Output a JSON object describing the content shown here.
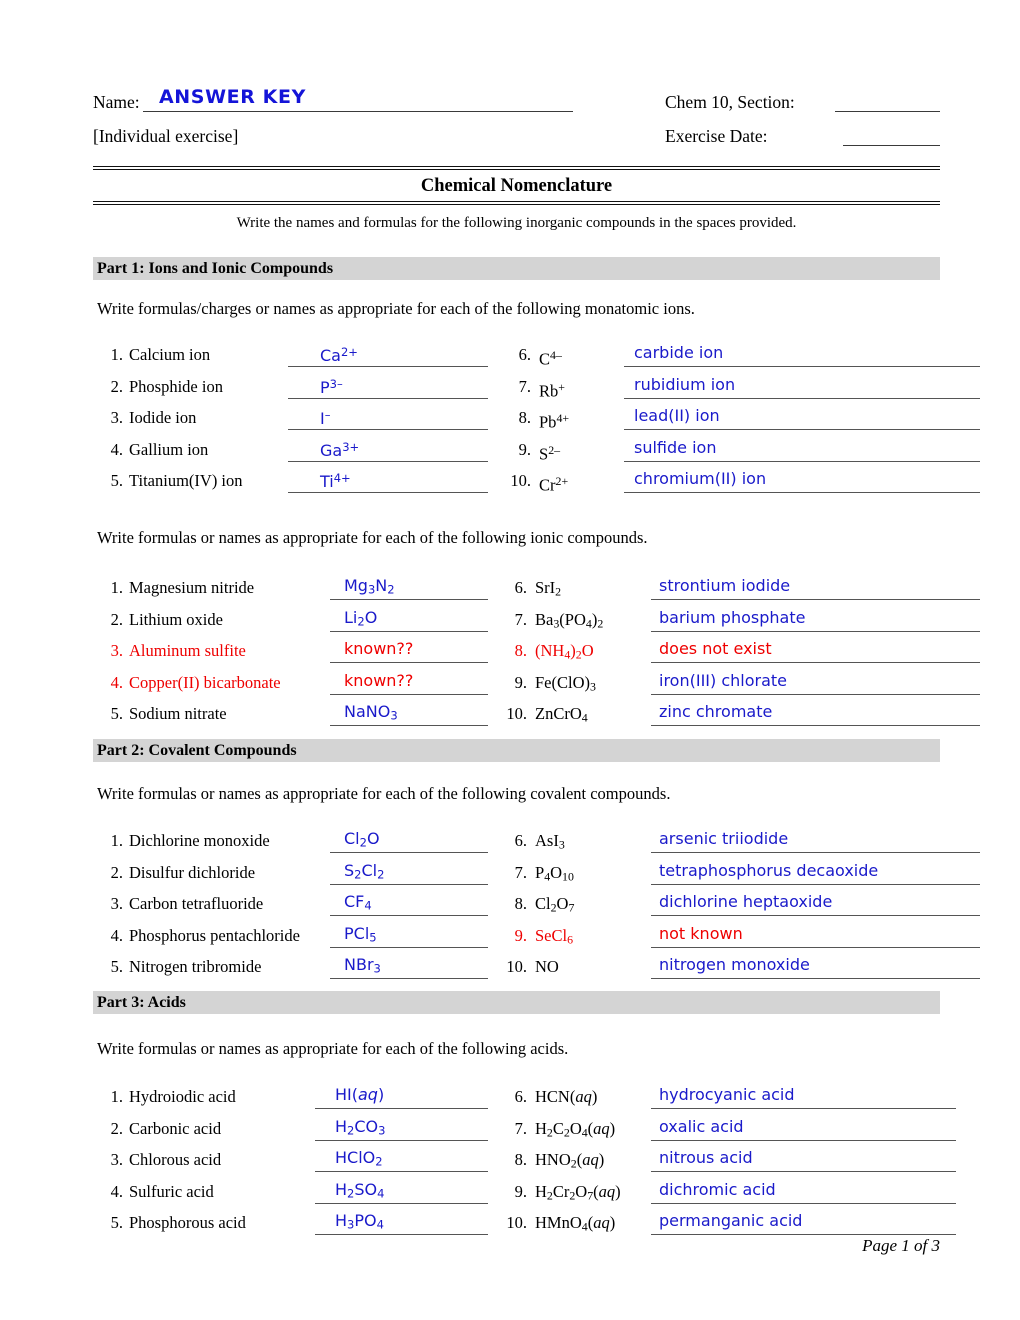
{
  "header": {
    "name_label": "Name:",
    "answer_key": "ANSWER KEY",
    "individual_exercise": "[Individual  exercise]",
    "chem_section_label": "Chem 10, Section:",
    "exercise_date_label": "Exercise Date:"
  },
  "title": "Chemical Nomenclature",
  "intro": "Write the names and formulas for the following inorganic compounds in the spaces provided.",
  "colors": {
    "answer_blue": "#1a1aca",
    "answer_red": "#ee0000",
    "section_bar": "#d4d4d4",
    "answer_key_blue": "#1414d8"
  },
  "part1": {
    "bar": "Part 1:  Ions and Ionic Compounds",
    "instruction_ions": "Write formulas/charges or names as appropriate for each of the following monatomic ions.",
    "instruction_ionic": "Write formulas or names as appropriate for each of the following ionic compounds.",
    "ions_left": [
      {
        "n": "1.",
        "prompt": "Calcium ion",
        "answer_html": "Ca<sup>2+</sup>",
        "red": false
      },
      {
        "n": "2.",
        "prompt": "Phosphide ion",
        "answer_html": "P<sup>3–</sup>",
        "red": false
      },
      {
        "n": "3.",
        "prompt": "Iodide ion",
        "answer_html": "I<sup>–</sup>",
        "red": false
      },
      {
        "n": "4.",
        "prompt": "Gallium ion",
        "answer_html": "Ga<sup>3+</sup>",
        "red": false
      },
      {
        "n": "5.",
        "prompt": "Titanium(IV) ion",
        "answer_html": "Ti<sup>4+</sup>",
        "red": false
      }
    ],
    "ions_right": [
      {
        "n": "6.",
        "prompt_html": "C<sup>4–</sup>",
        "answer_html": "carbide ion",
        "red": false
      },
      {
        "n": "7.",
        "prompt_html": "Rb<sup>+</sup>",
        "answer_html": "rubidium ion",
        "red": false
      },
      {
        "n": "8.",
        "prompt_html": "Pb<sup>4+</sup>",
        "answer_html": "lead(II) ion",
        "red": false
      },
      {
        "n": "9.",
        "prompt_html": "S<sup>2–</sup>",
        "answer_html": "sulfide ion",
        "red": false
      },
      {
        "n": "10.",
        "prompt_html": "Cr<sup>2+</sup>",
        "answer_html": "chromium(II) ion",
        "red": false
      }
    ],
    "ionic_left": [
      {
        "n": "1.",
        "prompt": "Magnesium nitride",
        "answer_html": "Mg<sub>3</sub>N<sub>2</sub>",
        "red": false
      },
      {
        "n": "2.",
        "prompt": "Lithium oxide",
        "answer_html": "Li<sub>2</sub>O",
        "red": false
      },
      {
        "n": "3.",
        "prompt": "Aluminum sulfite",
        "answer_html": "known??",
        "red": true
      },
      {
        "n": "4.",
        "prompt": "Copper(II) bicarbonate",
        "answer_html": "known??",
        "red": true
      },
      {
        "n": "5.",
        "prompt": "Sodium nitrate",
        "answer_html": "NaNO<sub>3</sub>",
        "red": false
      }
    ],
    "ionic_right": [
      {
        "n": "6.",
        "prompt_html": "SrI<sub>2</sub>",
        "answer_html": "strontium iodide",
        "red": false
      },
      {
        "n": "7.",
        "prompt_html": "Ba<sub>3</sub>(PO<sub>4</sub>)<sub>2</sub>",
        "answer_html": "barium phosphate",
        "red": false
      },
      {
        "n": "8.",
        "prompt_html": "(NH<sub>4</sub>)<sub>2</sub>O",
        "answer_html": "does not exist",
        "red": true
      },
      {
        "n": "9.",
        "prompt_html": "Fe(ClO)<sub>3</sub>",
        "answer_html": "iron(III) chlorate",
        "red": false
      },
      {
        "n": "10.",
        "prompt_html": "ZnCrO<sub>4</sub>",
        "answer_html": "zinc chromate",
        "red": false
      }
    ]
  },
  "part2": {
    "bar": "Part 2:  Covalent Compounds",
    "instruction": "Write formulas or names as appropriate for each of the following covalent compounds.",
    "left": [
      {
        "n": "1.",
        "prompt": "Dichlorine monoxide",
        "answer_html": "Cl<sub>2</sub>O",
        "red": false
      },
      {
        "n": "2.",
        "prompt": "Disulfur dichloride",
        "answer_html": "S<sub>2</sub>Cl<sub>2</sub>",
        "red": false
      },
      {
        "n": "3.",
        "prompt": "Carbon tetrafluoride",
        "answer_html": "CF<sub>4</sub>",
        "red": false
      },
      {
        "n": "4.",
        "prompt": "Phosphorus pentachloride",
        "answer_html": "PCl<sub>5</sub>",
        "red": false
      },
      {
        "n": "5.",
        "prompt": "Nitrogen tribromide",
        "answer_html": "NBr<sub>3</sub>",
        "red": false
      }
    ],
    "right": [
      {
        "n": "6.",
        "prompt_html": "AsI<sub>3</sub>",
        "answer_html": "arsenic triiodide",
        "red": false
      },
      {
        "n": "7.",
        "prompt_html": "P<sub>4</sub>O<sub>10</sub>",
        "answer_html": "tetraphosphorus decaoxide",
        "red": false
      },
      {
        "n": "8.",
        "prompt_html": "Cl<sub>2</sub>O<sub>7</sub>",
        "answer_html": "dichlorine heptaoxide",
        "red": false
      },
      {
        "n": "9.",
        "prompt_html": "SeCl<sub>6</sub>",
        "answer_html": "not known",
        "red": true
      },
      {
        "n": "10.",
        "prompt_html": "NO",
        "answer_html": "nitrogen monoxide",
        "red": false
      }
    ]
  },
  "part3": {
    "bar": "Part 3:  Acids",
    "instruction": "Write formulas or names as appropriate for each of the following acids.",
    "left": [
      {
        "n": "1.",
        "prompt": "Hydroiodic acid",
        "answer_html": "HI(<span class=\"it\">aq</span>)",
        "red": false
      },
      {
        "n": "2.",
        "prompt": "Carbonic acid",
        "answer_html": "H<sub>2</sub>CO<sub>3</sub>",
        "red": false
      },
      {
        "n": "3.",
        "prompt": "Chlorous acid",
        "answer_html": "HClO<sub>2</sub>",
        "red": false
      },
      {
        "n": "4.",
        "prompt": "Sulfuric acid",
        "answer_html": "H<sub>2</sub>SO<sub>4</sub>",
        "red": false
      },
      {
        "n": "5.",
        "prompt": "Phosphorous acid",
        "answer_html": "H<sub>3</sub>PO<sub>4</sub>",
        "red": false
      }
    ],
    "right": [
      {
        "n": "6.",
        "prompt_html": "HCN(<span class=\"it\">aq</span>)",
        "answer_html": "hydrocyanic acid",
        "red": false
      },
      {
        "n": "7.",
        "prompt_html": "H<sub>2</sub>C<sub>2</sub>O<sub>4</sub>(<span class=\"it\">aq</span>)",
        "answer_html": "oxalic acid",
        "red": false
      },
      {
        "n": "8.",
        "prompt_html": "HNO<sub>2</sub>(<span class=\"it\">aq</span>)",
        "answer_html": "nitrous acid",
        "red": false
      },
      {
        "n": "9.",
        "prompt_html": "H<sub>2</sub>Cr<sub>2</sub>O<sub>7</sub>(<span class=\"it\">aq</span>)",
        "answer_html": "dichromic acid",
        "red": false
      },
      {
        "n": "10.",
        "prompt_html": "HMnO<sub>4</sub>(<span class=\"it\">aq</span>)",
        "answer_html": "permanganic acid",
        "red": false
      }
    ]
  },
  "footer": "Page 1 of 3"
}
